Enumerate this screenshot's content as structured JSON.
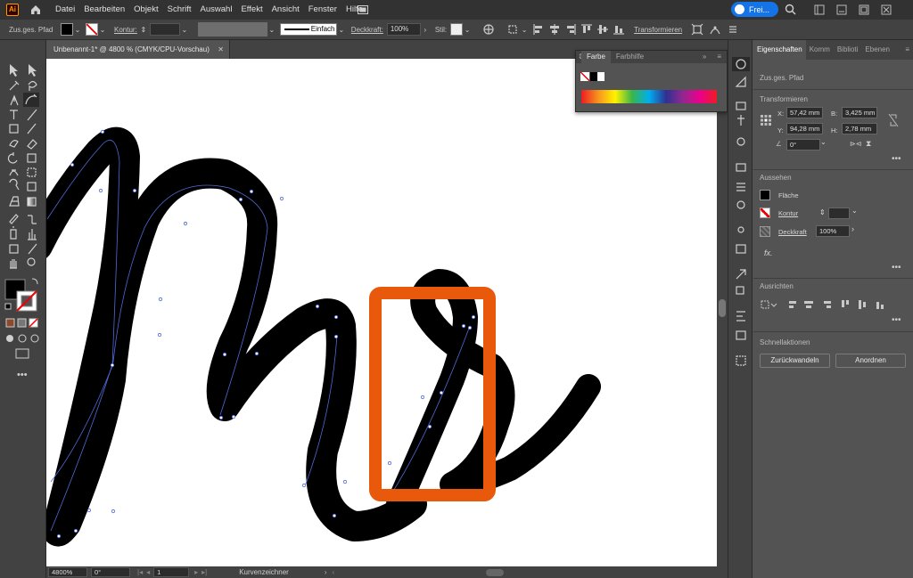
{
  "app": {
    "logo_text": "Ai",
    "menu": [
      "Datei",
      "Bearbeiten",
      "Objekt",
      "Schrift",
      "Auswahl",
      "Effekt",
      "Ansicht",
      "Fenster",
      "Hilfe"
    ],
    "share_label": "Frei...",
    "window_controls": [
      "minimize",
      "restore",
      "close"
    ]
  },
  "controlbar": {
    "object_type": "Zus.ges. Pfad",
    "kontur_label": "Kontur:",
    "stroke_style": "Einfach",
    "deckkraft_label": "Deckkraft:",
    "deckkraft_value": "100%",
    "stil_label": "Stil:",
    "transform_label": "Transformieren"
  },
  "document": {
    "tab_title": "Unbenannt-1* @ 4800 % (CMYK/CPU-Vorschau)"
  },
  "color_panel": {
    "tabs": [
      "Farbe",
      "Farbhilfe"
    ]
  },
  "status": {
    "zoom": "4800%",
    "rotation": "0°",
    "artboard_index": "1",
    "tool_name": "Kurvenzeichner"
  },
  "properties": {
    "tabs": [
      "Eigenschaften",
      "Komm",
      "Biblioti",
      "Ebenen"
    ],
    "object_type": "Zus.ges. Pfad",
    "transform": {
      "title": "Transformieren",
      "x_label": "X:",
      "x_value": "57,42 mm",
      "y_label": "Y:",
      "y_value": "94,28 mm",
      "w_label": "B:",
      "w_value": "3,425 mm",
      "h_label": "H:",
      "h_value": "2,78 mm",
      "angle_value": "0°"
    },
    "appearance": {
      "title": "Aussehen",
      "fill_label": "Fläche",
      "stroke_label": "Kontur",
      "opacity_label": "Deckkraft",
      "opacity_value": "100%",
      "fx_label": "fx."
    },
    "align": {
      "title": "Ausrichten"
    },
    "quick_actions": {
      "title": "Schnellaktionen",
      "revert_label": "Zurückwandeln",
      "arrange_label": "Anordnen"
    }
  },
  "colors": {
    "accent": "#1473e6",
    "highlight_box": "#e8590c",
    "path_selection": "#4f6bd8"
  }
}
